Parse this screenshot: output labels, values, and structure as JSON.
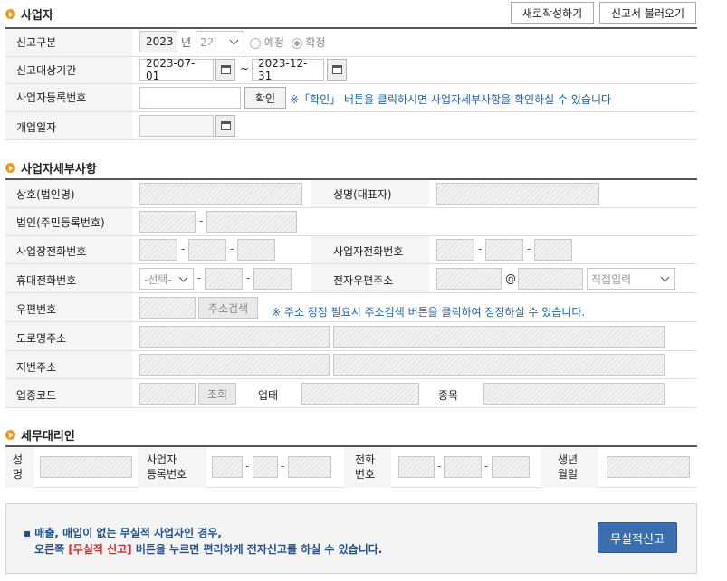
{
  "business": {
    "title": "사업자",
    "new_btn": "새로작성하기",
    "load_btn": "신고서 불러오기",
    "report_type_label": "신고구분",
    "year_value": "2023",
    "year_unit": "년",
    "period_value": "2기",
    "radio_planned": "예정",
    "radio_final": "확정",
    "period_label": "신고대상기간",
    "date_from": "2023-07-01",
    "date_sep": "~",
    "date_to": "2023-12-31",
    "reg_label": "사업자등록번호",
    "confirm_btn": "확인",
    "confirm_note": "※「확인」 버튼을 클릭하시면 사업자세부사항을 확인하실 수 있습니다",
    "open_date_label": "개업일자"
  },
  "detail": {
    "title": "사업자세부사항",
    "company_label": "상호(법인명)",
    "rep_label": "성명(대표자)",
    "corp_id_label": "법인(주민등록번호)",
    "shop_phone_label": "사업장전화번호",
    "biz_phone_label": "사업자전화번호",
    "mobile_label": "휴대전화번호",
    "mobile_select": "-선택-",
    "email_label": "전자우편주소",
    "email_at": "@",
    "email_domain_select": "직접입력",
    "zip_label": "우편번호",
    "addr_search_btn": "주소검색",
    "addr_note": "※ 주소 정정 필요시 주소검색 버튼을 클릭하여 정정하실 수 있습니다.",
    "road_addr_label": "도로명주소",
    "lot_addr_label": "지번주소",
    "industry_label": "업종코드",
    "lookup_btn": "조회",
    "biz_type_label": "업태",
    "biz_item_label": "종목",
    "dash": "-"
  },
  "agent": {
    "title": "세무대리인",
    "name_label_1": "성",
    "name_label_2": "명",
    "reg_label_1": "사업자",
    "reg_label_2": "등록번호",
    "phone_label_1": "전화",
    "phone_label_2": "번호",
    "birth_label_1": "생년",
    "birth_label_2": "월일"
  },
  "notice": {
    "line1_prefix": "▪ 매출, 매입이 없는 무실적 사업자인 경우,",
    "line2_a": "오른쪽 ",
    "line2_highlight": "[무실적 신고]",
    "line2_b": " 버튼을 누르면 편리하게 전자신고를 하실 수 있습니다.",
    "no_perf_btn": "무실적신고"
  },
  "colors": {
    "accent_orange": "#f39a1e",
    "note_blue": "#1f63a8",
    "primary_btn": "#3a6eae",
    "highlight_red": "#d62b2b"
  }
}
